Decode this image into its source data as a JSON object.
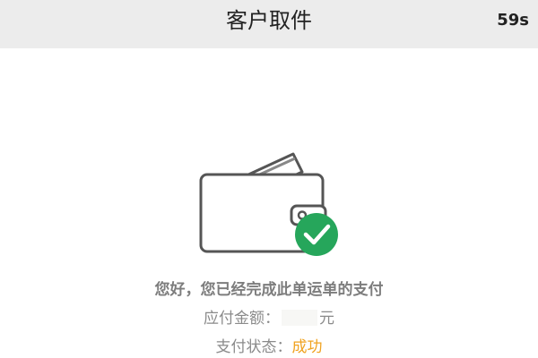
{
  "header": {
    "title": "客户取件",
    "countdown": "59s"
  },
  "wallet": {
    "icon": "wallet-icon",
    "badge_icon": "check-icon",
    "badge_color": "#26a65b"
  },
  "message": {
    "main": "您好，您已经完成此单运单的支付",
    "amount_label": "应付金额：",
    "amount_value": "",
    "amount_unit": "元",
    "status_label": "支付状态：",
    "status_value": "成功",
    "status_color": "#f0a321"
  }
}
